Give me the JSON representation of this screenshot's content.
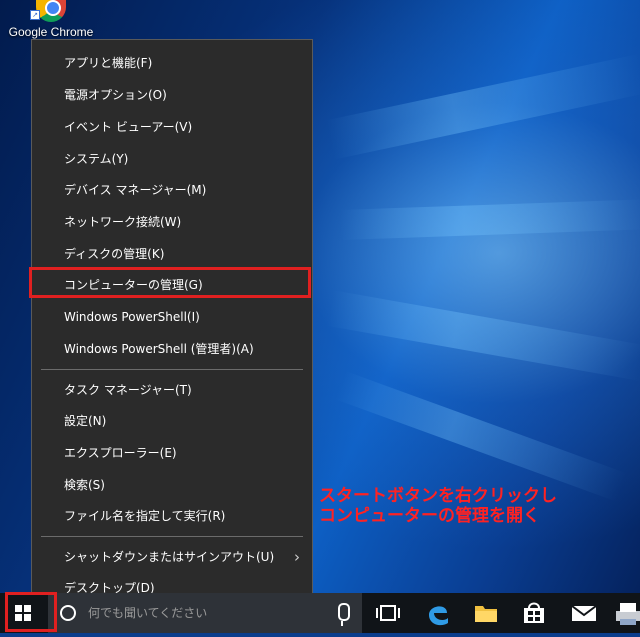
{
  "desktop": {
    "shortcut_label": "Google Chrome"
  },
  "menu": {
    "items": [
      {
        "label": "アプリと機能(F)"
      },
      {
        "label": "電源オプション(O)"
      },
      {
        "label": "イベント ビューアー(V)"
      },
      {
        "label": "システム(Y)"
      },
      {
        "label": "デバイス マネージャー(M)"
      },
      {
        "label": "ネットワーク接続(W)"
      },
      {
        "label": "ディスクの管理(K)"
      },
      {
        "label": "コンピューターの管理(G)"
      },
      {
        "label": "Windows PowerShell(I)"
      },
      {
        "label": "Windows PowerShell (管理者)(A)"
      },
      {
        "label": "タスク マネージャー(T)"
      },
      {
        "label": "設定(N)"
      },
      {
        "label": "エクスプローラー(E)"
      },
      {
        "label": "検索(S)"
      },
      {
        "label": "ファイル名を指定して実行(R)"
      },
      {
        "label": "シャットダウンまたはサインアウト(U)"
      },
      {
        "label": "デスクトップ(D)"
      }
    ]
  },
  "annotation": {
    "line1": "スタートボタンを右クリックし",
    "line2": "コンピューターの管理を開く"
  },
  "taskbar": {
    "search_placeholder": "何でも聞いてください",
    "icons": [
      "start-icon",
      "search-icon",
      "microphone-icon",
      "task-view-icon",
      "edge-icon",
      "file-explorer-icon",
      "store-icon",
      "mail-icon",
      "printer-icon"
    ]
  },
  "colors": {
    "menu_bg": "#2b2b2b",
    "highlight": "#e02020",
    "annotation": "#ff2222",
    "taskbar": "#101418"
  }
}
